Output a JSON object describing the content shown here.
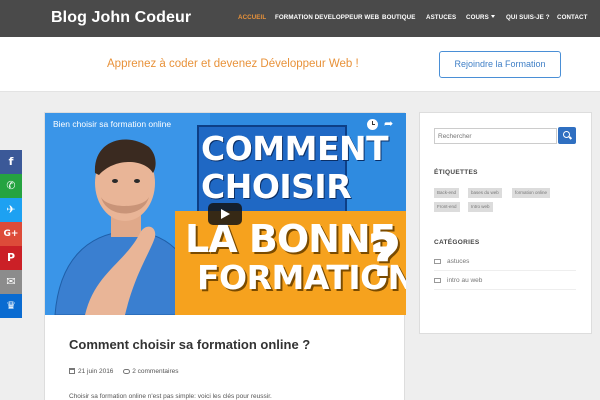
{
  "nav": {
    "brand": "Blog John Codeur",
    "items": [
      "ACCUEIL",
      "FORMATION DEVELOPPEUR WEB",
      "BOUTIQUE",
      "ASTUCES",
      "COURS",
      "QUI SUIS-JE ?",
      "CONTACT"
    ],
    "active": "ACCUEIL"
  },
  "banner": {
    "tagline": "Apprenez à coder et devenez Développeur Web !",
    "cta_label": "Rejoindre la Formation"
  },
  "post": {
    "video_title": "Bien choisir sa formation online",
    "thumbnail_lines": [
      "COMMENT",
      "CHOISIR",
      "LA BONNE",
      "FORMATION"
    ],
    "thumbnail_qmark": "?",
    "title": "Comment choisir sa formation online ?",
    "date": "21 juin 2016",
    "comments": "2 commentaires",
    "excerpt": "Choisir sa formation online n'est pas simple: voici les clés pour reussir."
  },
  "sidebar": {
    "search_placeholder": "Rechercher",
    "tags_heading": "ÉTIQUETTES",
    "tags": [
      "Back-end",
      "bases du web",
      "formation online",
      "Front-end",
      "Intro web"
    ],
    "categories_heading": "CATÉGORIES",
    "categories": [
      "astuces",
      "intro au web"
    ]
  },
  "share": {
    "buttons": [
      {
        "icon": "facebook-icon",
        "glyph": "f",
        "color": "#3b5998"
      },
      {
        "icon": "whatsapp-icon",
        "glyph": "✆",
        "color": "#25a340"
      },
      {
        "icon": "twitter-icon",
        "glyph": "✈",
        "color": "#1da1f2"
      },
      {
        "icon": "google-plus-icon",
        "glyph": "G+",
        "color": "#dd4b39"
      },
      {
        "icon": "pinterest-icon",
        "glyph": "P",
        "color": "#cb2027"
      },
      {
        "icon": "email-icon",
        "glyph": "✉",
        "color": "#8c8c8c"
      },
      {
        "icon": "sumome-icon",
        "glyph": "♛",
        "color": "#0a6bd1"
      }
    ]
  },
  "colors": {
    "accent": "#e8923a",
    "nav_bg": "#4a4a4a",
    "link_blue": "#3f7fc6"
  }
}
